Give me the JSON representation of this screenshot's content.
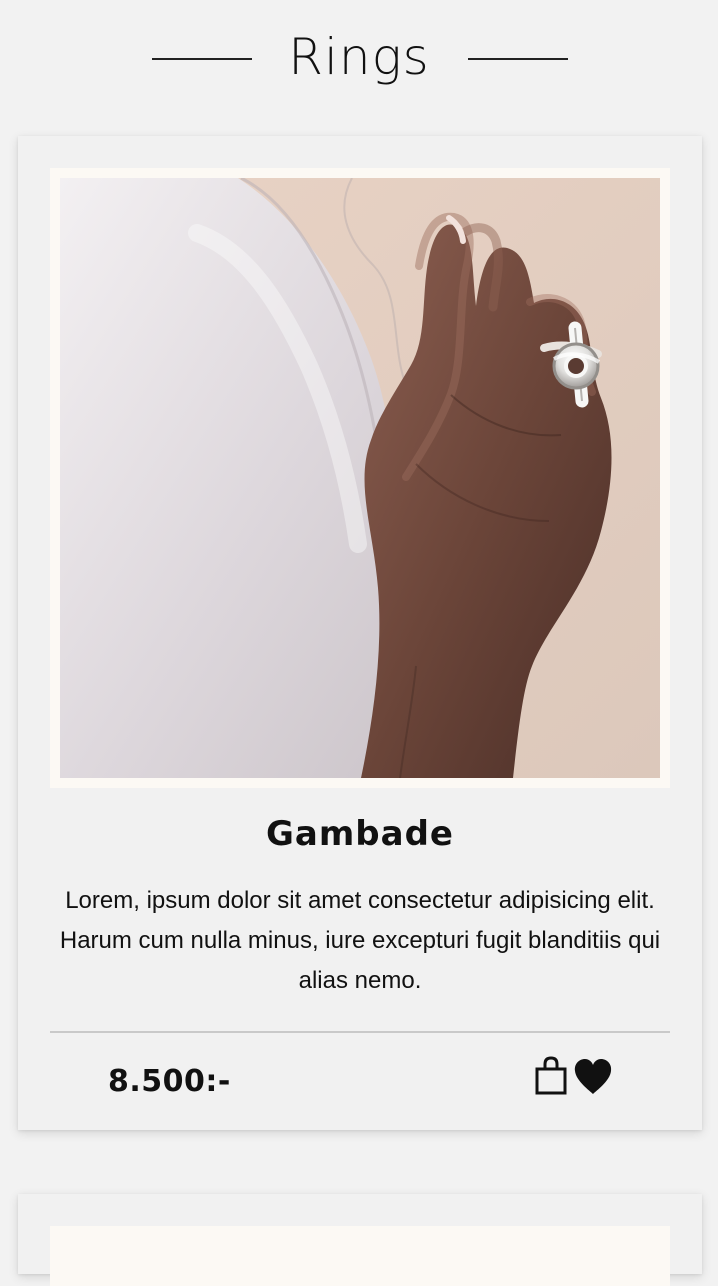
{
  "section": {
    "title": "Rings"
  },
  "product": {
    "name": "Gambade",
    "description": "Lorem, ipsum dolor sit amet consectetur adipisicing elit. Harum cum nulla minus, iure excepturi fugit blanditiis qui alias nemo.",
    "price": "8.500:-",
    "image_icon": "ring-hand-photo",
    "cart_icon": "shopping-bag-icon",
    "favorite_icon": "heart-icon"
  },
  "colors": {
    "background": "#f2f2f2",
    "card": "#f1f1f1",
    "image_border": "#fcf9f4",
    "text": "#111111",
    "divider": "#c9c9c9"
  }
}
